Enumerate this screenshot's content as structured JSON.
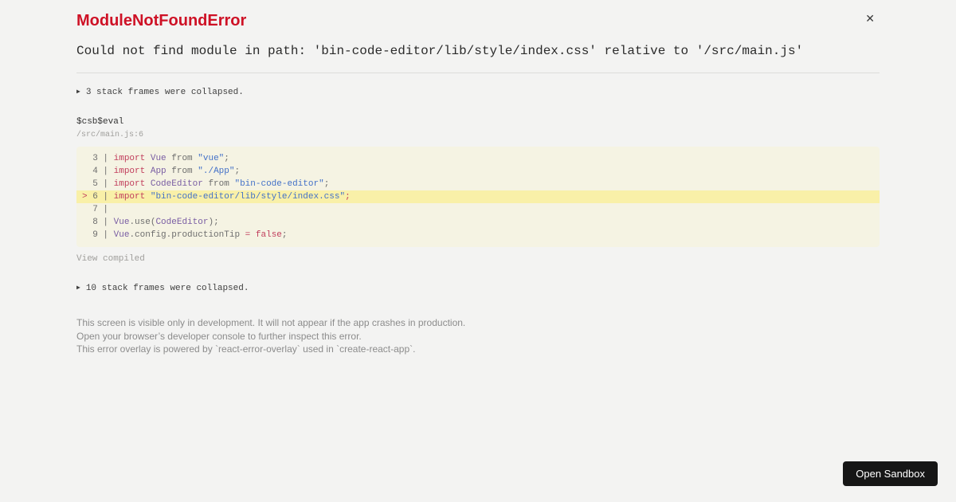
{
  "header": {
    "title": "ModuleNotFoundError",
    "close_icon": "✕",
    "message": "Could not find module in path: 'bin-code-editor/lib/style/index.css' relative to '/src/main.js'"
  },
  "stack": {
    "arrow_icon": "▶",
    "top_collapsed": "3 stack frames were collapsed.",
    "bottom_collapsed": "10 stack frames were collapsed."
  },
  "frame": {
    "function": "$csb$eval",
    "location": "/src/main.js:6",
    "view_compiled": "View compiled"
  },
  "code": {
    "lines": [
      {
        "num": "3",
        "marker": "",
        "highlight": false,
        "tokens": [
          {
            "c": "kw",
            "t": "import"
          },
          {
            "c": "pl",
            "t": " "
          },
          {
            "c": "cap",
            "t": "Vue"
          },
          {
            "c": "pl",
            "t": " from "
          },
          {
            "c": "str",
            "t": "\"vue\""
          },
          {
            "c": "pl",
            "t": ";"
          }
        ]
      },
      {
        "num": "4",
        "marker": "",
        "highlight": false,
        "tokens": [
          {
            "c": "kw",
            "t": "import"
          },
          {
            "c": "pl",
            "t": " "
          },
          {
            "c": "cap",
            "t": "App"
          },
          {
            "c": "pl",
            "t": " from "
          },
          {
            "c": "str",
            "t": "\"./App\""
          },
          {
            "c": "pl",
            "t": ";"
          }
        ]
      },
      {
        "num": "5",
        "marker": "",
        "highlight": false,
        "tokens": [
          {
            "c": "kw",
            "t": "import"
          },
          {
            "c": "pl",
            "t": " "
          },
          {
            "c": "cap",
            "t": "CodeEditor"
          },
          {
            "c": "pl",
            "t": " from "
          },
          {
            "c": "str",
            "t": "\"bin-code-editor\""
          },
          {
            "c": "pl",
            "t": ";"
          }
        ]
      },
      {
        "num": "6",
        "marker": ">",
        "highlight": true,
        "tokens": [
          {
            "c": "kw",
            "t": "import"
          },
          {
            "c": "pl",
            "t": " "
          },
          {
            "c": "str",
            "t": "\"bin-code-editor/lib/style/index.css\""
          },
          {
            "c": "kw",
            "t": ";"
          }
        ]
      },
      {
        "num": "7",
        "marker": "",
        "highlight": false,
        "tokens": []
      },
      {
        "num": "8",
        "marker": "",
        "highlight": false,
        "tokens": [
          {
            "c": "cap",
            "t": "Vue"
          },
          {
            "c": "pl",
            "t": ".use("
          },
          {
            "c": "cap",
            "t": "CodeEditor"
          },
          {
            "c": "pl",
            "t": ");"
          }
        ]
      },
      {
        "num": "9",
        "marker": "",
        "highlight": false,
        "tokens": [
          {
            "c": "cap",
            "t": "Vue"
          },
          {
            "c": "pl",
            "t": ".config.productionTip "
          },
          {
            "c": "op",
            "t": "="
          },
          {
            "c": "pl",
            "t": " "
          },
          {
            "c": "kw",
            "t": "false"
          },
          {
            "c": "pl",
            "t": ";"
          }
        ]
      }
    ]
  },
  "footer": {
    "lines": [
      "This screen is visible only in development. It will not appear if the app crashes in production.",
      "Open your browser’s developer console to further inspect this error.",
      "This error overlay is powered by `react-error-overlay` used in `create-react-app`."
    ]
  },
  "open_sandbox": {
    "label": "Open Sandbox"
  },
  "colors": {
    "accent_red": "#ce1126",
    "page_background": "#f3f3f2",
    "code_block_background": "#f5f3e3",
    "highlight_line": "#f9f0a8",
    "code_keyword": "#c13e5c",
    "code_string": "#4371c8",
    "code_identifier": "#795da3",
    "code_plain": "#6e6e6e",
    "button_background": "#161616"
  }
}
